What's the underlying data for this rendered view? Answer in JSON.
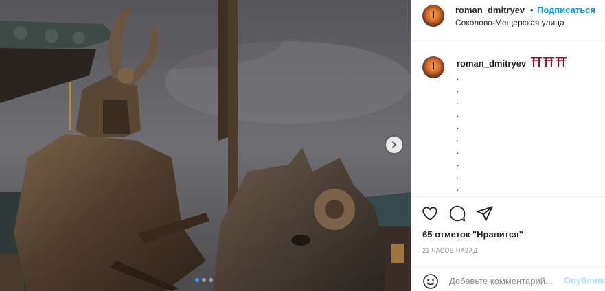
{
  "post": {
    "username": "roman_dmitryev",
    "separator": "•",
    "follow_label": "Подписаться",
    "location": "Соколово-Мещерская улица",
    "caption_emoji": [
      "torii-gate",
      "torii-gate",
      "torii-gate"
    ],
    "caption_lines": [
      ".",
      ".",
      ".",
      ".",
      ".",
      ".",
      ".",
      ".",
      ".",
      "."
    ],
    "likes_text": "65 отметок \"Нравится\"",
    "time_ago": "21 ЧАСОВ НАЗАД",
    "comment_placeholder": "Добавьте комментарий...",
    "publish_label": "Опубликовать"
  },
  "carousel": {
    "slide_count": 3,
    "active_index": 0
  },
  "icons": {
    "like": "heart-icon",
    "comment": "speech-bubble-icon",
    "share": "paper-plane-icon",
    "emoji": "smiley-icon",
    "next": "chevron-right-icon"
  },
  "colors": {
    "link_blue": "#0095f6",
    "publish_disabled": "#b2dffc",
    "torii_red": "#8c1d2a",
    "muted": "#8e8e8e"
  }
}
